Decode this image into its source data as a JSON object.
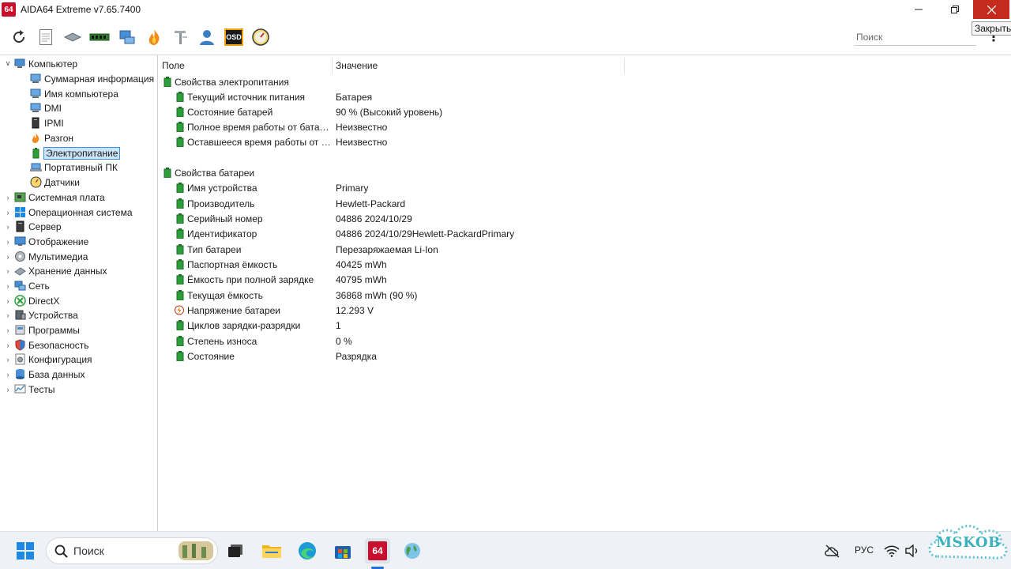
{
  "window": {
    "title": "AIDA64 Extreme v7.65.7400",
    "logo_text": "64",
    "close_tooltip": "Закрыть"
  },
  "toolbar": {
    "search_placeholder": "Поиск",
    "osd_label": "OSD"
  },
  "tree": {
    "items": [
      {
        "label": "Компьютер",
        "icon": "computer-icon"
      },
      {
        "label": "Суммарная информация",
        "icon": "summary-icon"
      },
      {
        "label": "Имя компьютера",
        "icon": "computer-name-icon"
      },
      {
        "label": "DMI",
        "icon": "dmi-icon"
      },
      {
        "label": "IPMI",
        "icon": "ipmi-icon"
      },
      {
        "label": "Разгон",
        "icon": "overclock-icon"
      },
      {
        "label": "Электропитание",
        "icon": "power-icon"
      },
      {
        "label": "Портативный ПК",
        "icon": "laptop-icon"
      },
      {
        "label": "Датчики",
        "icon": "sensor-icon"
      },
      {
        "label": "Системная плата",
        "icon": "motherboard-icon"
      },
      {
        "label": "Операционная система",
        "icon": "windows-icon"
      },
      {
        "label": "Сервер",
        "icon": "server-icon"
      },
      {
        "label": "Отображение",
        "icon": "display-icon"
      },
      {
        "label": "Мультимедиа",
        "icon": "multimedia-icon"
      },
      {
        "label": "Хранение данных",
        "icon": "storage-icon"
      },
      {
        "label": "Сеть",
        "icon": "network-icon"
      },
      {
        "label": "DirectX",
        "icon": "directx-icon"
      },
      {
        "label": "Устройства",
        "icon": "devices-icon"
      },
      {
        "label": "Программы",
        "icon": "programs-icon"
      },
      {
        "label": "Безопасность",
        "icon": "security-icon"
      },
      {
        "label": "Конфигурация",
        "icon": "config-icon"
      },
      {
        "label": "База данных",
        "icon": "database-icon"
      },
      {
        "label": "Тесты",
        "icon": "benchmark-icon"
      }
    ]
  },
  "table": {
    "col_field": "Поле",
    "col_value": "Значение",
    "groups": [
      {
        "title": "Свойства электропитания",
        "rows": [
          {
            "field": "Текущий источник питания",
            "value": "Батарея"
          },
          {
            "field": "Состояние батарей",
            "value": "90 % (Высокий уровень)"
          },
          {
            "field": "Полное время работы от батар...",
            "value": "Неизвестно"
          },
          {
            "field": "Оставшееся время работы от б...",
            "value": "Неизвестно"
          }
        ]
      },
      {
        "title": "Свойства батареи",
        "rows": [
          {
            "field": "Имя устройства",
            "value": "Primary"
          },
          {
            "field": "Производитель",
            "value": "Hewlett-Packard"
          },
          {
            "field": "Серийный номер",
            "value": "04886 2024/10/29"
          },
          {
            "field": "Идентификатор",
            "value": "04886 2024/10/29Hewlett-PackardPrimary"
          },
          {
            "field": "Тип батареи",
            "value": "Перезаряжаемая Li-Ion"
          },
          {
            "field": "Паспортная ёмкость",
            "value": "40425 mWh"
          },
          {
            "field": "Ёмкость при полной зарядке",
            "value": "40795 mWh"
          },
          {
            "field": "Текущая ёмкость",
            "value": "36868 mWh  (90 %)"
          },
          {
            "field": "Напряжение батареи",
            "value": "12.293 V"
          },
          {
            "field": "Циклов зарядки-разрядки",
            "value": "1"
          },
          {
            "field": "Степень износа",
            "value": "0 %"
          },
          {
            "field": "Состояние",
            "value": "Разрядка"
          }
        ]
      }
    ]
  },
  "taskbar": {
    "search_label": "Поиск",
    "language": "РУС",
    "aida_label": "64"
  },
  "watermark": {
    "text": "MSKOB"
  },
  "colors": {
    "accent_blue": "#3c8fd8",
    "selection_bg": "#cce4f7",
    "close_red": "#c42b1c",
    "aida_red": "#c8102e",
    "leaf_green": "#2e9e3a"
  }
}
